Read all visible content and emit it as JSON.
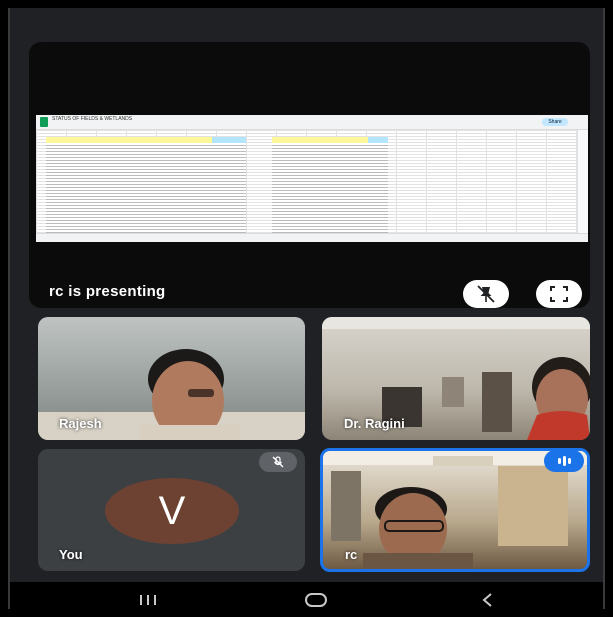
{
  "presentation": {
    "label": "rc is presenting",
    "sheet_title": "STATUS OF FIELDS & WETLANDS",
    "share_label": "Share"
  },
  "participants": [
    {
      "name": "Rajesh",
      "speaking": false,
      "muted": false
    },
    {
      "name": "Dr. Ragini",
      "speaking": false,
      "muted": false
    },
    {
      "name": "You",
      "avatar_letter": "V",
      "avatar_color": "#6d4232",
      "muted": true
    },
    {
      "name": "rc",
      "speaking": true,
      "muted": false
    }
  ],
  "icons": {
    "pin": "pin-off-icon",
    "fullscreen": "fullscreen-icon",
    "mic_off": "mic-off-icon",
    "speaking": "speaking-indicator-icon"
  },
  "colors": {
    "speaker_border": "#1a73e8",
    "tile_bg": "#3c4043"
  }
}
